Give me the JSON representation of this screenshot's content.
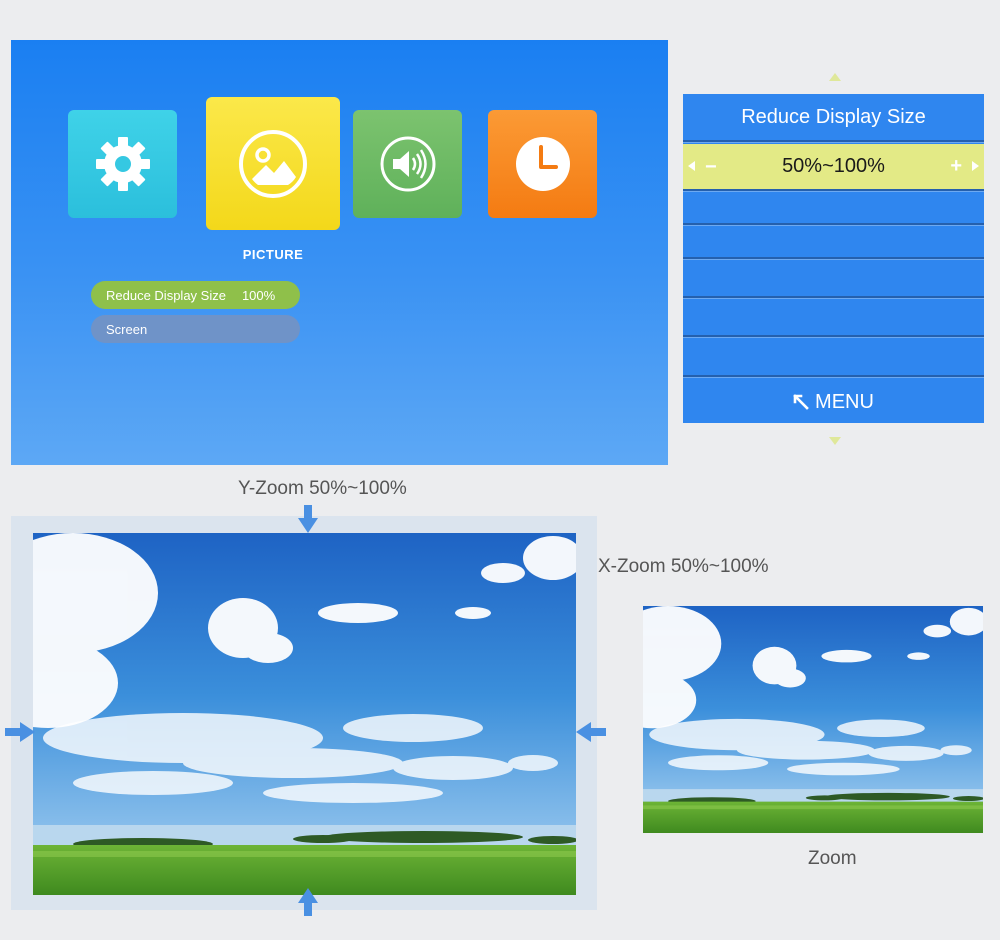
{
  "projector_menu": {
    "tiles": [
      {
        "name": "setup",
        "icon": "gear-icon",
        "color": "#2bbfdc"
      },
      {
        "name": "picture",
        "icon": "picture-icon",
        "color": "#f3d81a",
        "selected": true
      },
      {
        "name": "sound",
        "icon": "speaker-icon",
        "color": "#5fb15a"
      },
      {
        "name": "time",
        "icon": "clock-icon",
        "color": "#f47b12"
      }
    ],
    "selected_caption": "PICTURE",
    "items": [
      {
        "label": "Reduce Display Size",
        "value": "100%",
        "highlighted": true
      },
      {
        "label": "Screen"
      }
    ]
  },
  "osd_panel": {
    "title": "Reduce Display Size",
    "value": "50%~100%",
    "minus_symbol": "−",
    "plus_symbol": "+",
    "menu_label": "MENU",
    "menu_icon": "back-arrow-icon",
    "empty_rows": 5
  },
  "captions": {
    "y_zoom": "Y-Zoom 50%~100%",
    "x_zoom": "X-Zoom 50%~100%",
    "zoom": "Zoom"
  },
  "colors": {
    "menu_background": "#1a7ff2",
    "osd_background": "#2f86ef",
    "osd_highlight": "#e3ea86",
    "arrow_blue": "#4a90e2",
    "menu_item_active": "#8fc04a",
    "menu_item_inactive": "#6f93c8"
  }
}
